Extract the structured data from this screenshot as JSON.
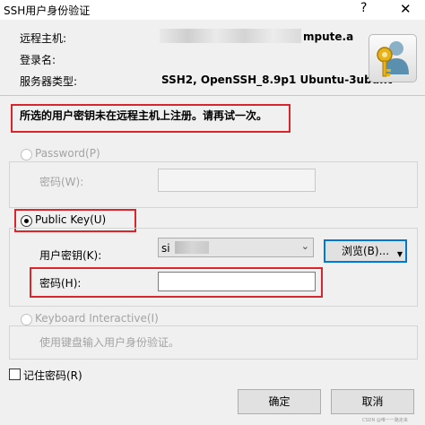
{
  "window": {
    "title": "SSH用户身份验证",
    "help_glyph": "?",
    "close_glyph": "✕"
  },
  "info": {
    "host_label": "远程主机:",
    "host_value": "mpute.a",
    "user_label": "登录名:",
    "server_type_label": "服务器类型:",
    "server_type_value": "SSH2, OpenSSH_8.9p1 Ubuntu-3ubunt"
  },
  "message": "所选的用户密钥未在远程主机上注册。请再试一次。",
  "password_option": {
    "label": "Password(P)",
    "field_label": "密码(W):"
  },
  "public_key_option": {
    "label": "Public Key(U)",
    "key_label": "用户密钥(K):",
    "key_value": "si",
    "browse_button": "浏览(B)...",
    "passphrase_label": "密码(H):"
  },
  "keyboard_option": {
    "label": "Keyboard Interactive(I)",
    "description": "使用键盘输入用户身份验证。"
  },
  "remember": {
    "label": "记住密码(R)"
  },
  "buttons": {
    "ok": "确定",
    "cancel": "取消"
  },
  "watermark": "CSDN @唯一一路走来",
  "colors": {
    "highlight_box": "#d9262c",
    "focus_border": "#0078d7"
  }
}
